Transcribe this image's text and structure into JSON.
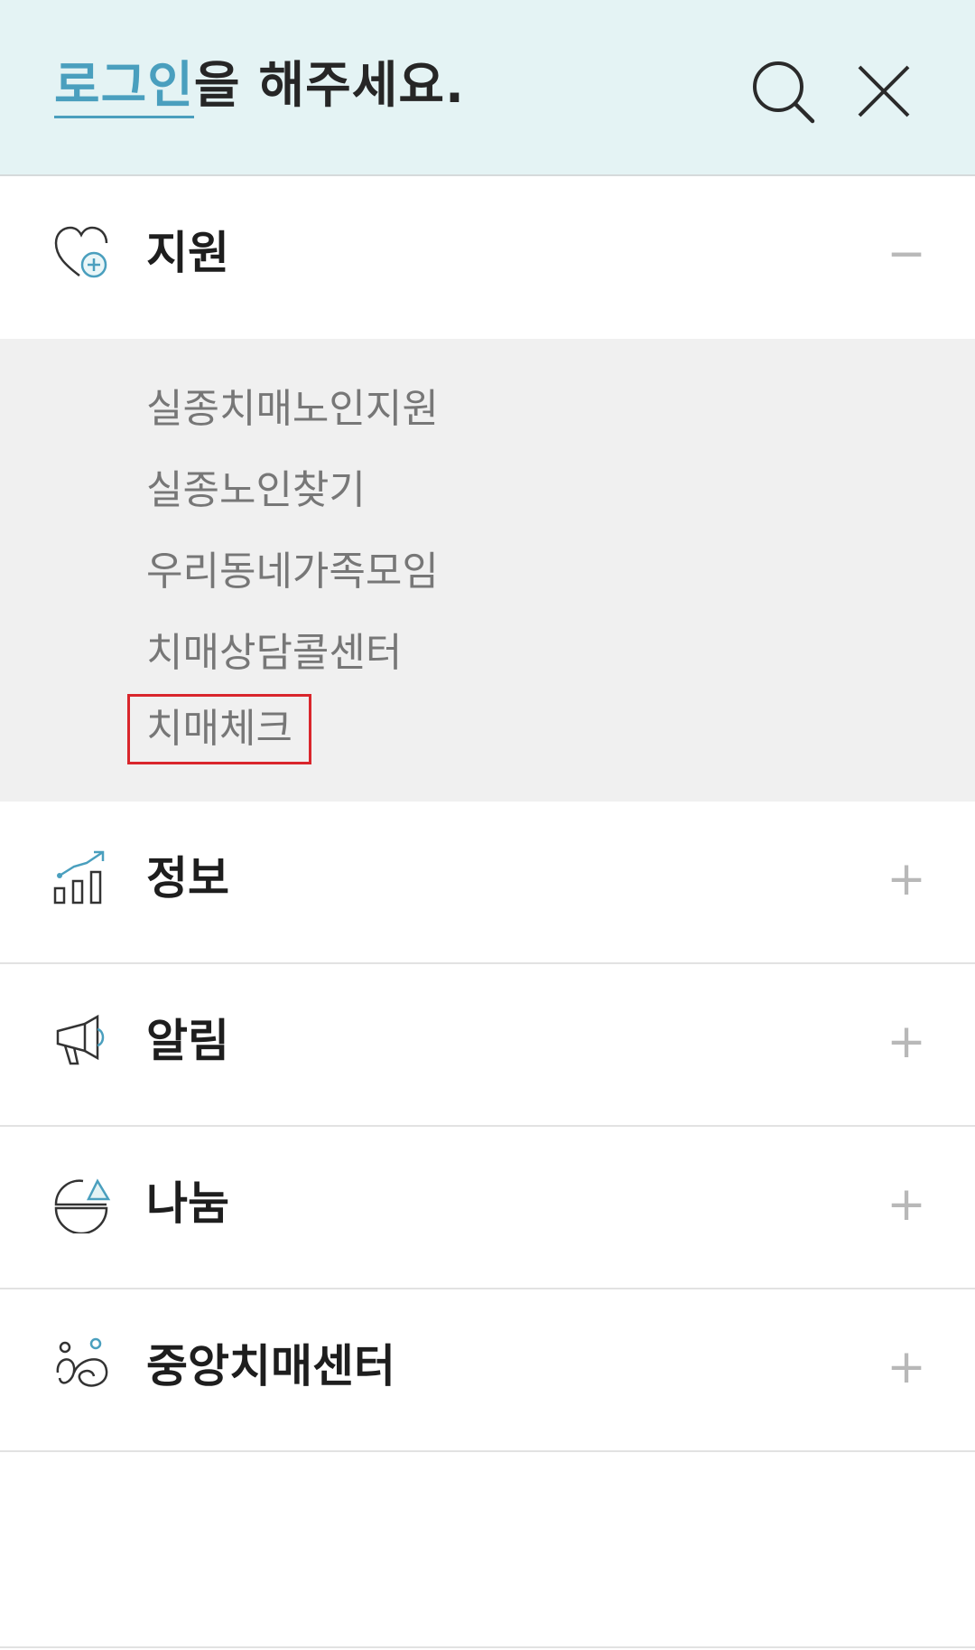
{
  "header": {
    "login_link": "로그인",
    "login_rest": "을 해주세요.",
    "search_icon": "search-icon",
    "close_icon": "close-icon"
  },
  "menu": {
    "sections": [
      {
        "label": "지원",
        "icon": "heart-plus-icon",
        "toggle": "−",
        "expanded": true
      },
      {
        "label": "정보",
        "icon": "chart-growth-icon",
        "toggle": "+",
        "expanded": false
      },
      {
        "label": "알림",
        "icon": "megaphone-icon",
        "toggle": "+",
        "expanded": false
      },
      {
        "label": "나눔",
        "icon": "share-pie-icon",
        "toggle": "+",
        "expanded": false
      },
      {
        "label": "중앙치매센터",
        "icon": "people-icon",
        "toggle": "+",
        "expanded": false
      }
    ],
    "support_items": [
      "실종치매노인지원",
      "실종노인찾기",
      "우리동네가족모임",
      "치매상담콜센터",
      "치매체크"
    ]
  },
  "colors": {
    "header_bg": "#e4f3f4",
    "accent": "#4a9fbe",
    "highlight_border": "#d9262c",
    "submenu_bg": "#f0f0f0"
  }
}
